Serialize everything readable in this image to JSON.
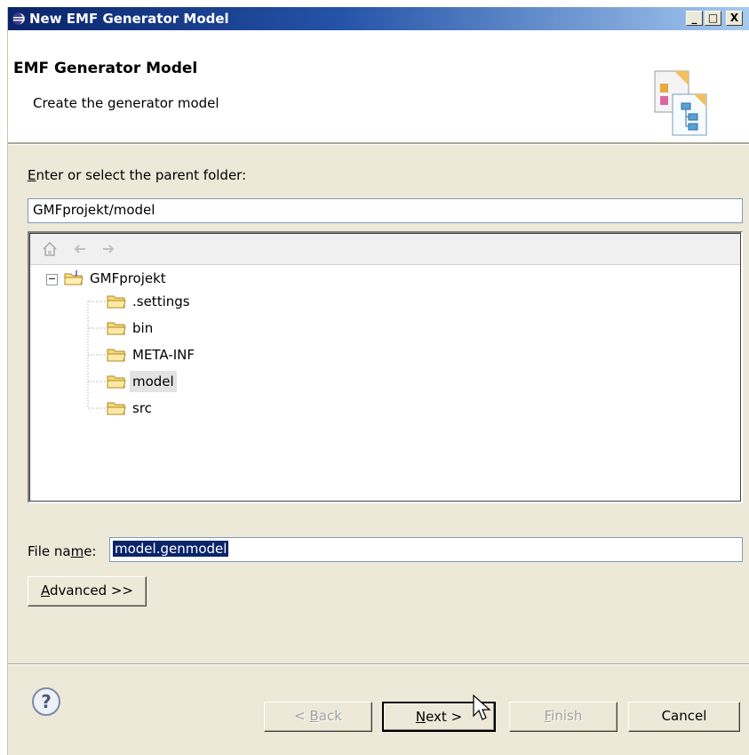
{
  "window": {
    "title": "New EMF Generator Model",
    "controls": {
      "minimize": "_",
      "maximize": "□",
      "close": "X"
    }
  },
  "header": {
    "title": "EMF Generator Model",
    "description": "Create the generator model",
    "icon": "genmodel-wizard-icon"
  },
  "folder": {
    "label_accel": "E",
    "label_rest": "nter or select the parent folder:",
    "value": "GMFprojekt/model"
  },
  "tree": {
    "nav": [
      "home-icon",
      "back-icon",
      "forward-icon"
    ],
    "root": {
      "label": "GMFprojekt",
      "expander": "−"
    },
    "children": [
      {
        "label": ".settings",
        "selected": false
      },
      {
        "label": "bin",
        "selected": false
      },
      {
        "label": "META-INF",
        "selected": false
      },
      {
        "label": "model",
        "selected": true
      },
      {
        "label": "src",
        "selected": false
      }
    ]
  },
  "filename": {
    "label_pre": "File na",
    "label_accel": "m",
    "label_post": "e:",
    "value": "model.genmodel"
  },
  "advanced": {
    "accel": "A",
    "rest": "dvanced >>"
  },
  "buttons": {
    "back": {
      "pre": "< ",
      "accel": "B",
      "rest": "ack"
    },
    "next": {
      "accel": "N",
      "rest": "ext >"
    },
    "finish": {
      "accel": "F",
      "rest": "inish"
    },
    "cancel": "Cancel"
  },
  "help_icon": "help-icon",
  "colors": {
    "title_bar": "#0a246a",
    "dialog_bg": "#ece9d8",
    "selection": "#0a246a"
  }
}
